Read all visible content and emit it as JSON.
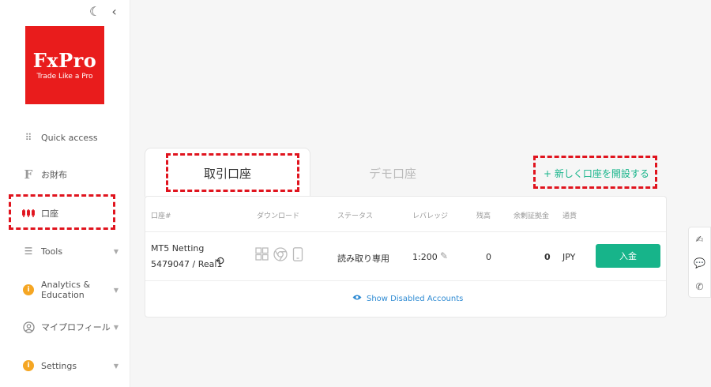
{
  "sidebar": {
    "logo": {
      "brand": "FxPro",
      "tagline": "Trade Like a Pro"
    },
    "items": [
      {
        "label": "Quick access"
      },
      {
        "label": "お財布"
      },
      {
        "label": "口座"
      },
      {
        "label": "Tools"
      },
      {
        "label": "Analytics &\nEducation"
      },
      {
        "label": "マイプロフィール"
      },
      {
        "label": "Settings"
      }
    ]
  },
  "tabs": [
    {
      "label": "取引口座"
    },
    {
      "label": "デモ口座"
    }
  ],
  "open_account": "+ 新しく口座を開設する",
  "table": {
    "headers": [
      "口座#",
      "ダウンロード",
      "ステータス",
      "レバレッジ",
      "残高",
      "余剰証拠金",
      "通貨"
    ],
    "row": {
      "account_type": "MT5 Netting",
      "account_id": "5479047 / Real1",
      "status": "読み取り専用",
      "leverage": "1:200",
      "balance": "0",
      "free_margin": "0",
      "currency": "JPY",
      "deposit_label": "入金"
    }
  },
  "show_disabled": "Show Disabled Accounts",
  "colors": {
    "brand_red": "#e91c1c",
    "accent_green": "#17b48a",
    "link_blue": "#2f8bd3",
    "annotation_red": "#e0141e"
  }
}
